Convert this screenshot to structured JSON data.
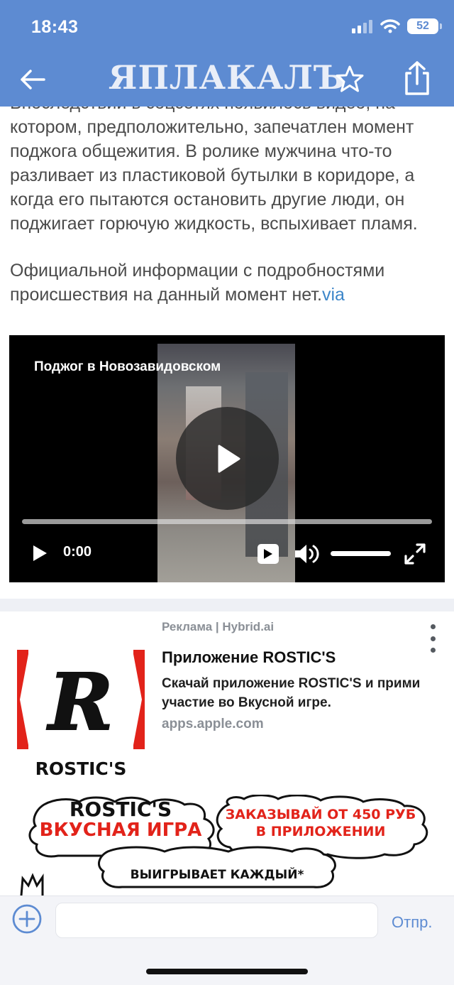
{
  "status": {
    "time": "18:43",
    "battery": "52"
  },
  "header": {
    "logo": "ЯПЛАКАЛЪ"
  },
  "article": {
    "partial_line": "Впоследствии в соцсетях появилось видео, на",
    "paragraph1": "котором, предположительно, запечатлен момент поджога общежития. В ролике мужчина что-то разливает из пластиковой бутылки в коридоре, а когда его пытаются остановить другие люди, он поджигает горючую жидкость, вспыхивает пламя.",
    "paragraph2": "Официальной информации с подробностями происшествия на данный момент нет.",
    "via": "via"
  },
  "video": {
    "title": "Поджог в Новозавидовском",
    "time": "0:00",
    "progress": 0,
    "volume": 1.0
  },
  "ad": {
    "label": "Реклама | Hybrid.ai",
    "title": "Приложение ROSTIC'S",
    "description": "Скачай приложение ROSTIC'S и прими участие во Вкусной игре.",
    "domain": "apps.apple.com",
    "logo_text": "ROSTIC'S",
    "banner": {
      "brand": "ROSTIC'S",
      "game": "ВКУСНАЯ ИГРА",
      "offer_line1": "ЗАКАЗЫВАЙ ОТ 450 РУБ",
      "offer_line2": "В ПРИЛОЖЕНИИ",
      "winner": "ВЫИГРЫВАЕТ КАЖДЫЙ*"
    }
  },
  "compose": {
    "placeholder": "",
    "send_label": "Отпр."
  },
  "colors": {
    "accent": "#5d8bd2",
    "brand_red": "#e2231a",
    "link": "#3d86c9"
  }
}
